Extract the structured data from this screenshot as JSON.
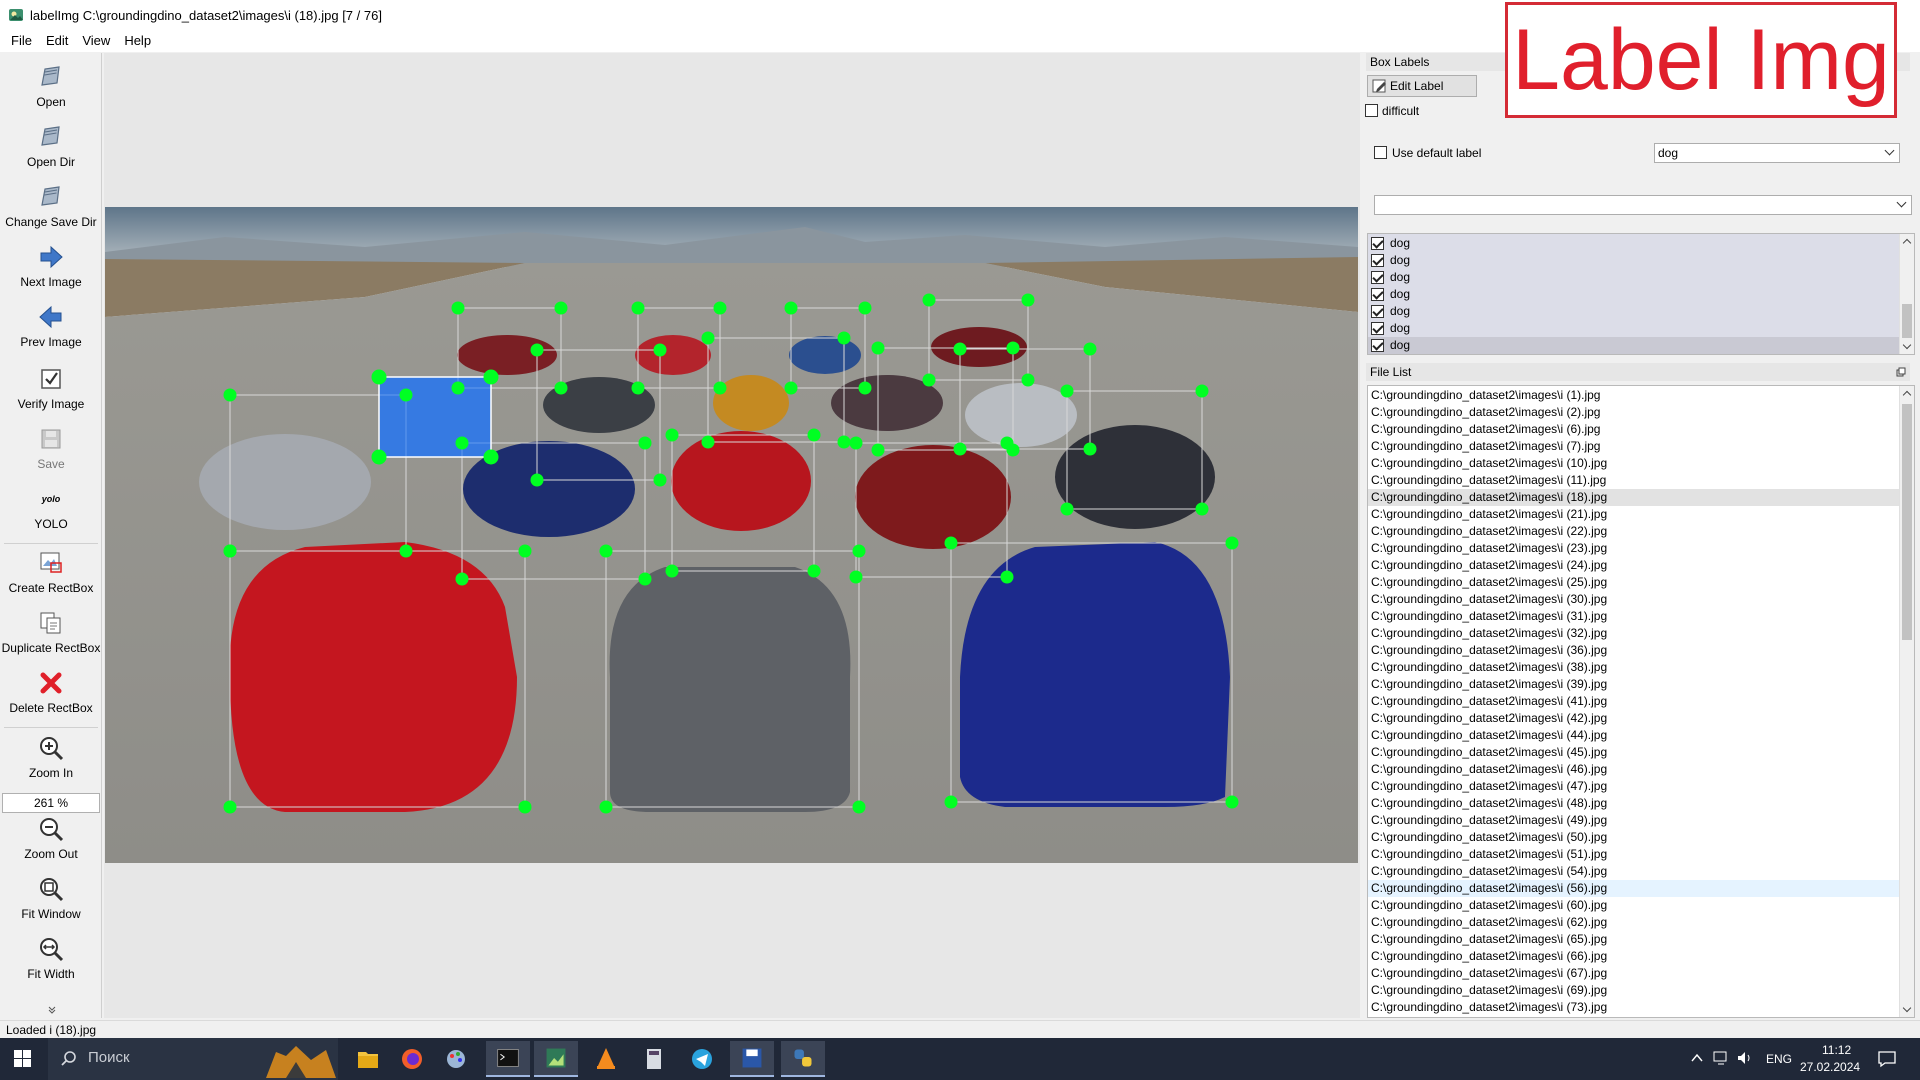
{
  "window": {
    "title": "labelImg C:\\groundingdino_dataset2\\images\\i (18).jpg [7 / 76]"
  },
  "menu": [
    "File",
    "Edit",
    "View",
    "Help"
  ],
  "toolbar": {
    "open": "Open",
    "open_dir": "Open Dir",
    "change_save_dir": "Change Save Dir",
    "next_image": "Next Image",
    "prev_image": "Prev Image",
    "verify_image": "Verify Image",
    "save": "Save",
    "format_icon_text": "yolo",
    "format": "YOLO",
    "create_rectbox": "Create RectBox",
    "duplicate_rectbox": "Duplicate RectBox",
    "delete_rectbox": "Delete RectBox",
    "zoom_in": "Zoom In",
    "zoom_value": "261 %",
    "zoom_out": "Zoom Out",
    "fit_window": "Fit Window",
    "fit_width": "Fit Width"
  },
  "box_labels": {
    "title": "Box Labels",
    "edit_label": "Edit Label",
    "difficult": "difficult",
    "use_default_label": "Use default label",
    "default_label_value": "dog",
    "label_combo_value": "",
    "items": [
      "dog",
      "dog",
      "dog",
      "dog",
      "dog",
      "dog",
      "dog"
    ]
  },
  "file_list": {
    "title": "File List",
    "selected_file": "C:\\groundingdino_dataset2\\images\\i (18).jpg",
    "hover_file": "C:\\groundingdino_dataset2\\images\\i (56).jpg",
    "files": [
      "C:\\groundingdino_dataset2\\images\\i (1).jpg",
      "C:\\groundingdino_dataset2\\images\\i (2).jpg",
      "C:\\groundingdino_dataset2\\images\\i (6).jpg",
      "C:\\groundingdino_dataset2\\images\\i (7).jpg",
      "C:\\groundingdino_dataset2\\images\\i (10).jpg",
      "C:\\groundingdino_dataset2\\images\\i (11).jpg",
      "C:\\groundingdino_dataset2\\images\\i (18).jpg",
      "C:\\groundingdino_dataset2\\images\\i (21).jpg",
      "C:\\groundingdino_dataset2\\images\\i (22).jpg",
      "C:\\groundingdino_dataset2\\images\\i (23).jpg",
      "C:\\groundingdino_dataset2\\images\\i (24).jpg",
      "C:\\groundingdino_dataset2\\images\\i (25).jpg",
      "C:\\groundingdino_dataset2\\images\\i (30).jpg",
      "C:\\groundingdino_dataset2\\images\\i (31).jpg",
      "C:\\groundingdino_dataset2\\images\\i (32).jpg",
      "C:\\groundingdino_dataset2\\images\\i (36).jpg",
      "C:\\groundingdino_dataset2\\images\\i (38).jpg",
      "C:\\groundingdino_dataset2\\images\\i (39).jpg",
      "C:\\groundingdino_dataset2\\images\\i (41).jpg",
      "C:\\groundingdino_dataset2\\images\\i (42).jpg",
      "C:\\groundingdino_dataset2\\images\\i (44).jpg",
      "C:\\groundingdino_dataset2\\images\\i (45).jpg",
      "C:\\groundingdino_dataset2\\images\\i (46).jpg",
      "C:\\groundingdino_dataset2\\images\\i (47).jpg",
      "C:\\groundingdino_dataset2\\images\\i (48).jpg",
      "C:\\groundingdino_dataset2\\images\\i (49).jpg",
      "C:\\groundingdino_dataset2\\images\\i (50).jpg",
      "C:\\groundingdino_dataset2\\images\\i (51).jpg",
      "C:\\groundingdino_dataset2\\images\\i (54).jpg",
      "C:\\groundingdino_dataset2\\images\\i (56).jpg",
      "C:\\groundingdino_dataset2\\images\\i (60).jpg",
      "C:\\groundingdino_dataset2\\images\\i (62).jpg",
      "C:\\groundingdino_dataset2\\images\\i (65).jpg",
      "C:\\groundingdino_dataset2\\images\\i (66).jpg",
      "C:\\groundingdino_dataset2\\images\\i (67).jpg",
      "C:\\groundingdino_dataset2\\images\\i (69).jpg",
      "C:\\groundingdino_dataset2\\images\\i (73).jpg"
    ]
  },
  "watermark": "Label Img",
  "status": "Loaded i (18).jpg",
  "taskbar": {
    "search_placeholder": "Поиск",
    "language": "ENG",
    "time": "11:12",
    "date": "27.02.2024"
  },
  "colors": {
    "handle": "#00ff22",
    "box_selected_fill": "#2f7be8",
    "watermark": "#e01f2c"
  }
}
